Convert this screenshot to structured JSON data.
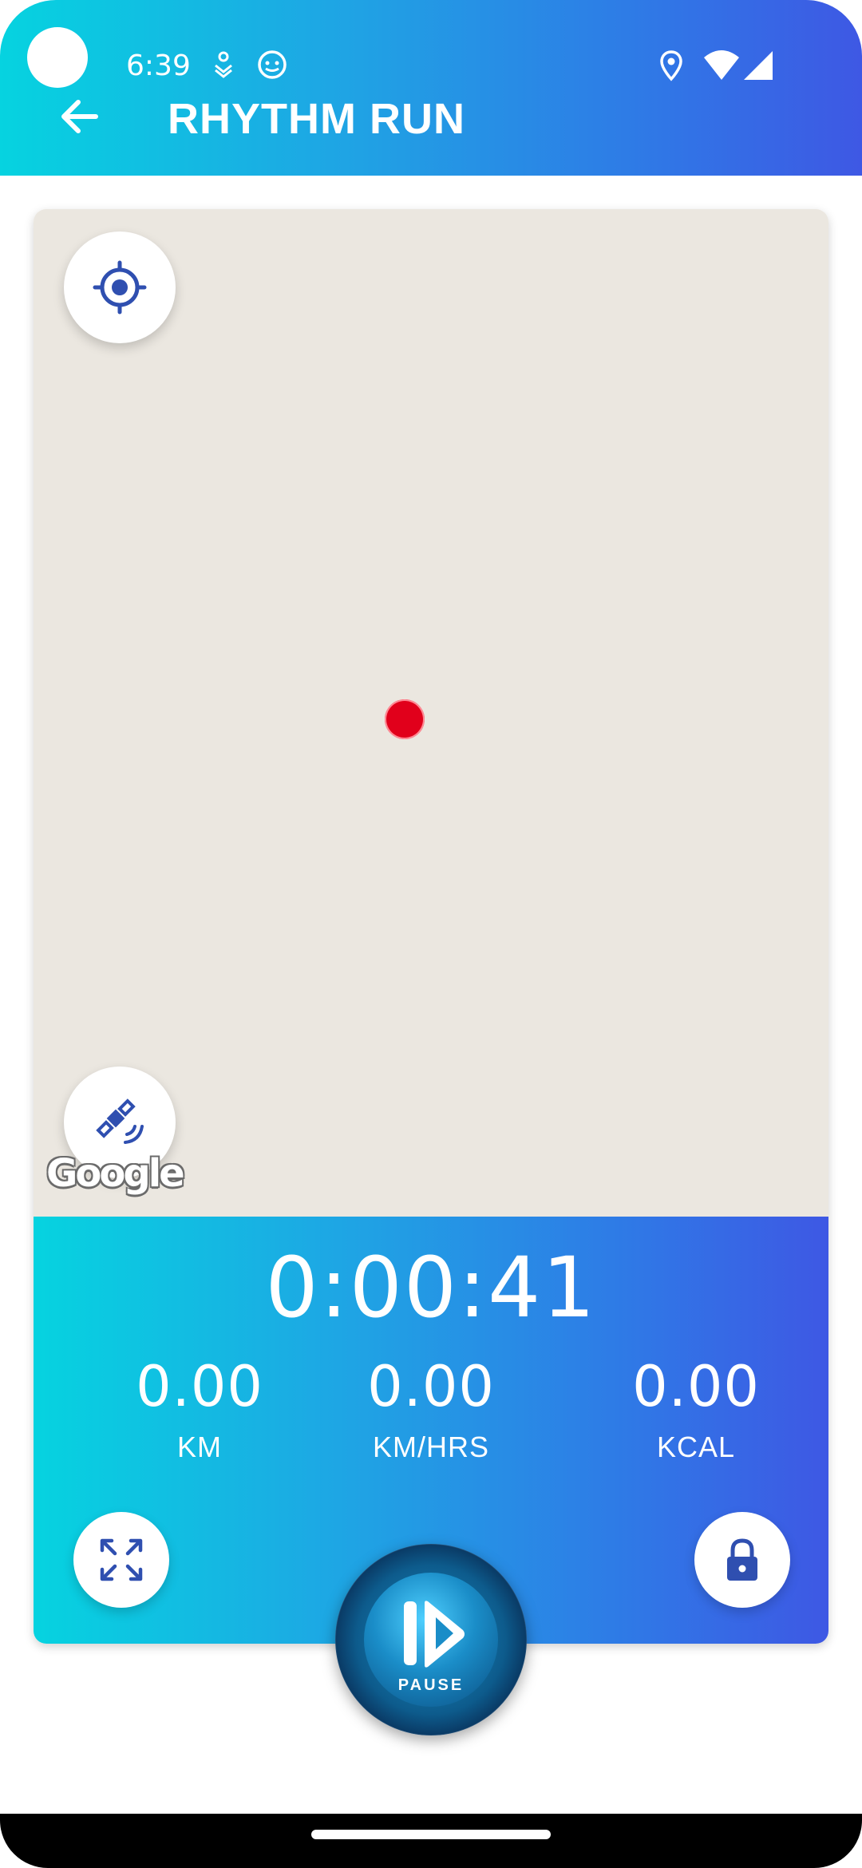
{
  "status_bar": {
    "time": "6:39"
  },
  "header": {
    "title": "RHYTHM RUN",
    "back_icon": "arrow-left-icon"
  },
  "map": {
    "attribution": "Google",
    "buttons": {
      "my_location_icon": "my-location-icon",
      "gps_icon": "satellite-icon"
    }
  },
  "stats": {
    "elapsed_time": "0:00:41",
    "metrics": [
      {
        "value": "0.00",
        "unit": "KM"
      },
      {
        "value": "0.00",
        "unit": "KM/HRS"
      },
      {
        "value": "0.00",
        "unit": "KCAL"
      }
    ]
  },
  "controls": {
    "pause_label": "PAUSE",
    "expand_icon": "expand-icon",
    "lock_icon": "lock-icon"
  },
  "colors": {
    "gradient_start": "#06d3e0",
    "gradient_end": "#3e58e4",
    "icon_blue": "#2f4fb0",
    "marker_red": "#e1001b",
    "map_bg": "#ebe7e0"
  }
}
